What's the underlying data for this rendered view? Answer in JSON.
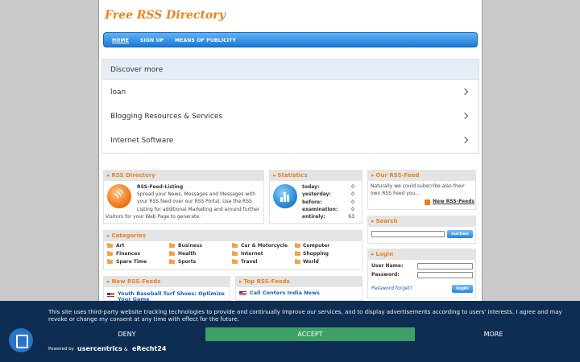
{
  "site": {
    "logo": "Free RSS Directory"
  },
  "nav": {
    "home": "HOME",
    "signup": "SIGN UP",
    "publicity": "MEANS OF PUBLICITY"
  },
  "discover": {
    "title": "Discover more",
    "items": [
      "loan",
      "Blogging Resources & Services",
      "Internet Software"
    ]
  },
  "rss_directory": {
    "title": "RSS Directory",
    "heading": "RSS-Feed-Listing",
    "lines": [
      "Spread your News, Messages and Messages with",
      "your RSS feed over our RSS Portal. Use the RSS",
      "Listing for additional Marketing and around further",
      "Visitors for your Web Page to generate."
    ]
  },
  "statistics": {
    "title": "Statistics",
    "rows": [
      {
        "label": "today:",
        "value": "0"
      },
      {
        "label": "yesterday:",
        "value": "0"
      },
      {
        "label": "before:",
        "value": "0"
      },
      {
        "label": "examination:",
        "value": "0"
      },
      {
        "label": "entirely:",
        "value": "63"
      }
    ]
  },
  "our_feed": {
    "title": "Our RSS-Feed",
    "lines": [
      "Naturally we could subscribe also their",
      "own RSS Feed you..."
    ],
    "link": "New RSS-Feeds"
  },
  "categories": {
    "title": "Categories",
    "items": [
      "Art",
      "Business",
      "Car & Motorcycle",
      "Computer",
      "Finances",
      "Health",
      "Internet",
      "Shopping",
      "Spare Time",
      "Sports",
      "Travel",
      "World"
    ]
  },
  "search": {
    "title": "Search",
    "button": "suchen"
  },
  "login": {
    "title": "Login",
    "user_label": "User Name:",
    "password_label": "Password:",
    "forgot": "Password forget?",
    "button": "login"
  },
  "new_feeds": {
    "title": "New RSS-Feeds",
    "item_line1": "Youth Baseball Turf Shoes: Optimize",
    "item_line2": "Your Game"
  },
  "top_feeds": {
    "title": "Top RSS-Feeds",
    "item": "Call Centers India News"
  },
  "consent": {
    "line1": "This site uses third-party website tracking technologies to provide and continually improve our services, and to display advertisements according to users' interests. I agree and may",
    "line2": "revoke or change my consent at any time with effect for the future.",
    "deny": "DENY",
    "accept": "ACCEPT",
    "more": "MORE",
    "powered": "Powered by",
    "usercentrics": "usercentrics",
    "amp": "&",
    "erecht": "eRecht24"
  }
}
